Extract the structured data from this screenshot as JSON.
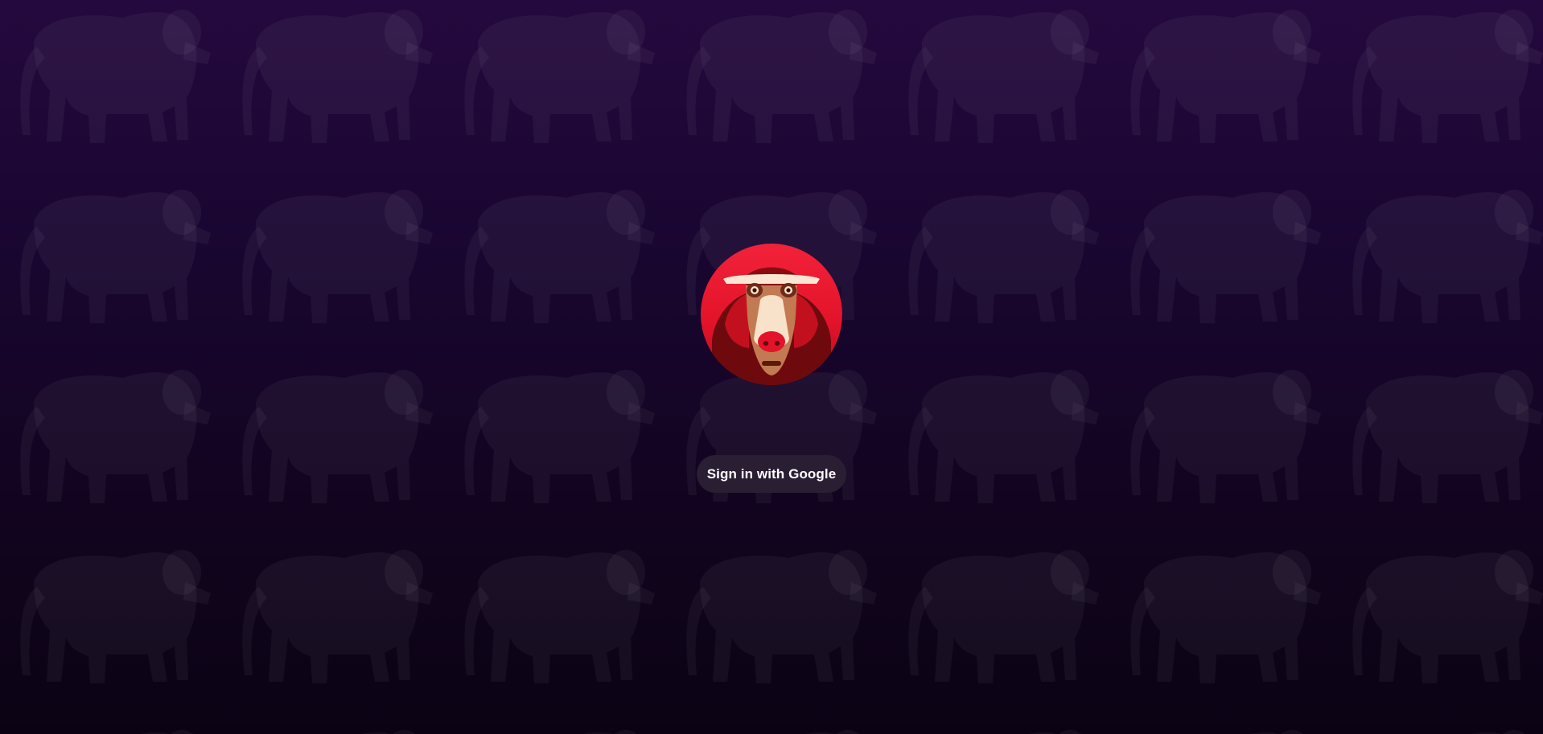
{
  "signin": {
    "label": "Sign in with Google"
  },
  "logo": {
    "icon": "baboon-face-icon"
  },
  "background": {
    "pattern_icon": "baboon-silhouette-icon",
    "gradient": [
      "#24093e",
      "#190630",
      "#12041f",
      "#0b0314"
    ],
    "pattern_color": "#ffffff"
  },
  "colors": {
    "brand_red": "#e3132a",
    "button_bg": "#2a1e33",
    "button_text": "#ffffff"
  }
}
